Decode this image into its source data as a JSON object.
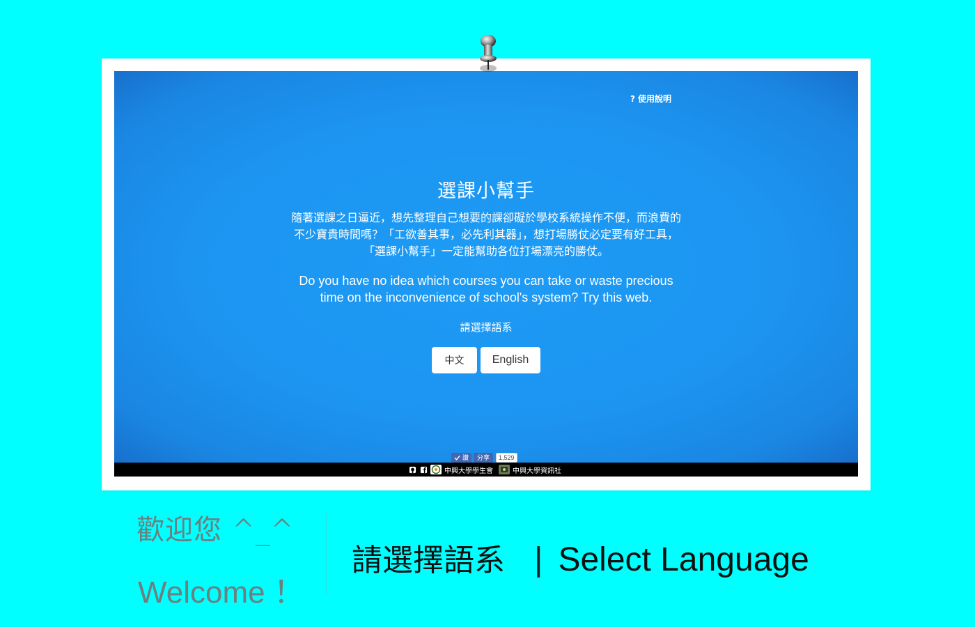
{
  "app": {
    "help_link": "使用說明",
    "help_icon": "?",
    "title": "選課小幫手",
    "intro_zh": "隨著選課之日逼近，想先整理自己想要的課卻礙於學校系統操作不便，而浪費的不少寶貴時間嗎？「工欲善其事，必先利其器」，想打場勝仗必定要有好工具，「選課小幫手」一定能幫助各位打場漂亮的勝仗。",
    "intro_en": "Do you have no idea which courses you can take or waste precious time on the inconvenience of school's system? Try this web.",
    "choose_language_label": "請選擇語系",
    "language_buttons": {
      "zh": "中文",
      "en": "English"
    }
  },
  "share": {
    "like_label": "讚",
    "share_label": "分享",
    "count": "1,529"
  },
  "footer": {
    "icons": [
      "github-icon",
      "facebook-icon"
    ],
    "link_1": "中興大學學生會",
    "link_2": "中興大學資訊社"
  },
  "caption": {
    "welcome_zh": "歡迎您 ^_^",
    "welcome_en": "Welcome ！",
    "select_zh": "請選擇語系",
    "separator": "|",
    "select_en": "Select Language"
  },
  "colors": {
    "page_background": "#00ffff",
    "screen_background": "#1f8ae8",
    "footer_bar": "#000000",
    "facebook_blue": "#4267b2",
    "welcome_text": "#6c8080"
  }
}
